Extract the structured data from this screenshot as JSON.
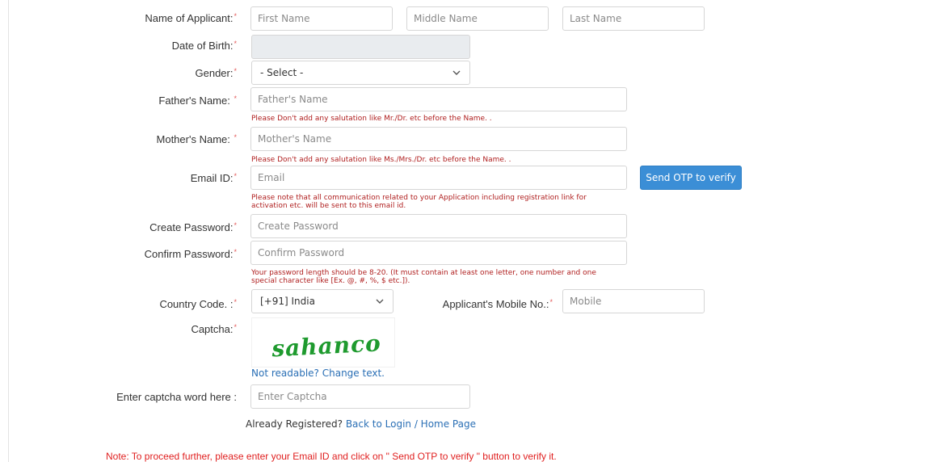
{
  "form": {
    "applicant_name": {
      "label": "Name of Applicant:",
      "first_placeholder": "First Name",
      "middle_placeholder": "Middle Name",
      "last_placeholder": "Last Name"
    },
    "dob": {
      "label": "Date of Birth:"
    },
    "gender": {
      "label": "Gender:",
      "selected": "- Select -"
    },
    "father": {
      "label": "Father's Name:",
      "placeholder": "Father's Name",
      "hint": "Please Don't add any salutation like Mr./Dr. etc before the Name. ."
    },
    "mother": {
      "label": "Mother's Name:",
      "placeholder": "Mother's Name",
      "hint": "Please Don't add any salutation like Ms./Mrs./Dr. etc before the Name. ."
    },
    "email": {
      "label": "Email ID:",
      "placeholder": "Email",
      "button": "Send OTP to verify",
      "hint_line1": "Please note that all communication related to your Application including registration link for",
      "hint_line2": "activation etc. will be sent to this email id."
    },
    "password": {
      "label": "Create Password:",
      "placeholder": "Create Password"
    },
    "confirm_password": {
      "label": "Confirm Password:",
      "placeholder": "Confirm Password",
      "hint_line1": "Your password length should be 8-20. (It must contain at least one letter, one number and one",
      "hint_line2": "special character like [Ex. @, #, %, $ etc.])."
    },
    "country_code": {
      "label": "Country Code. :",
      "selected": "[+91] India"
    },
    "mobile": {
      "label": "Applicant's Mobile No.:",
      "placeholder": "Mobile"
    },
    "captcha": {
      "label": "Captcha:",
      "image_text": "sahanco",
      "change_link": "Not readable? Change text."
    },
    "captcha_entry": {
      "label": "Enter captcha word here :",
      "placeholder": "Enter Captcha"
    }
  },
  "footer": {
    "already_text": "Already Registered?",
    "login_link": "Back to Login / Home Page",
    "note": "Note: To proceed further, please enter your Email ID and click on \" Send OTP to verify \" button to verify it."
  },
  "required_marker": "*",
  "colors": {
    "hint_text": "#b02020",
    "note_text": "#e02020",
    "button_bg": "#3b8ed6",
    "link": "#2a6fb5",
    "captcha_text": "#1e9a2e"
  }
}
